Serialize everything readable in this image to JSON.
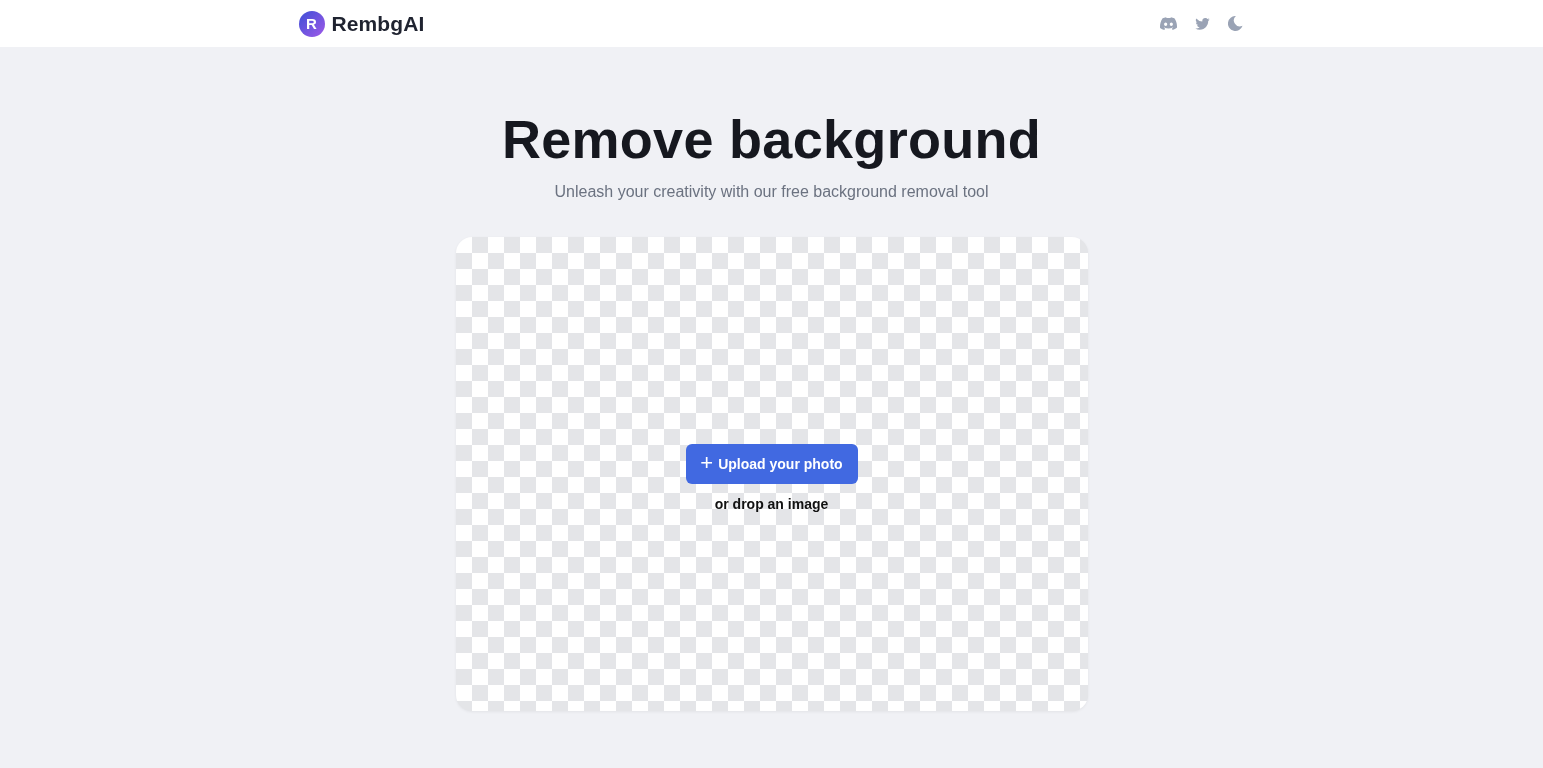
{
  "header": {
    "logo_letter": "R",
    "brand": "RembgAI"
  },
  "hero": {
    "title": "Remove background",
    "subtitle": "Unleash your creativity with our free background removal tool"
  },
  "dropzone": {
    "button_icon": "+",
    "button_label": "Upload your photo",
    "hint": "or drop an image"
  }
}
